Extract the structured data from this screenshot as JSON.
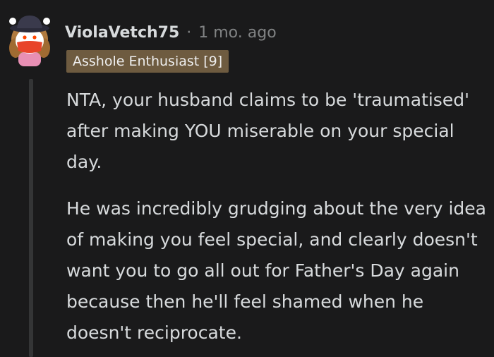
{
  "comment": {
    "username": "ViolaVetch75",
    "separator": "·",
    "time": "1 mo. ago",
    "flair": "Asshole Enthusiast [9]",
    "avatar_icon": "snoo-avatar-icon",
    "paragraphs": [
      "NTA, your husband claims to be 'traumatised' after making YOU miserable on your special day.",
      "He was incredibly grudging about the very idea of making you feel special, and clearly doesn't want you to go all out for Father's Day again because then he'll feel shamed when he doesn't reciprocate."
    ]
  },
  "colors": {
    "background": "#1a1a1b",
    "text": "#d7dadc",
    "meta": "#818384",
    "flair_bg": "#6e5b40",
    "thread_line": "#343536"
  }
}
